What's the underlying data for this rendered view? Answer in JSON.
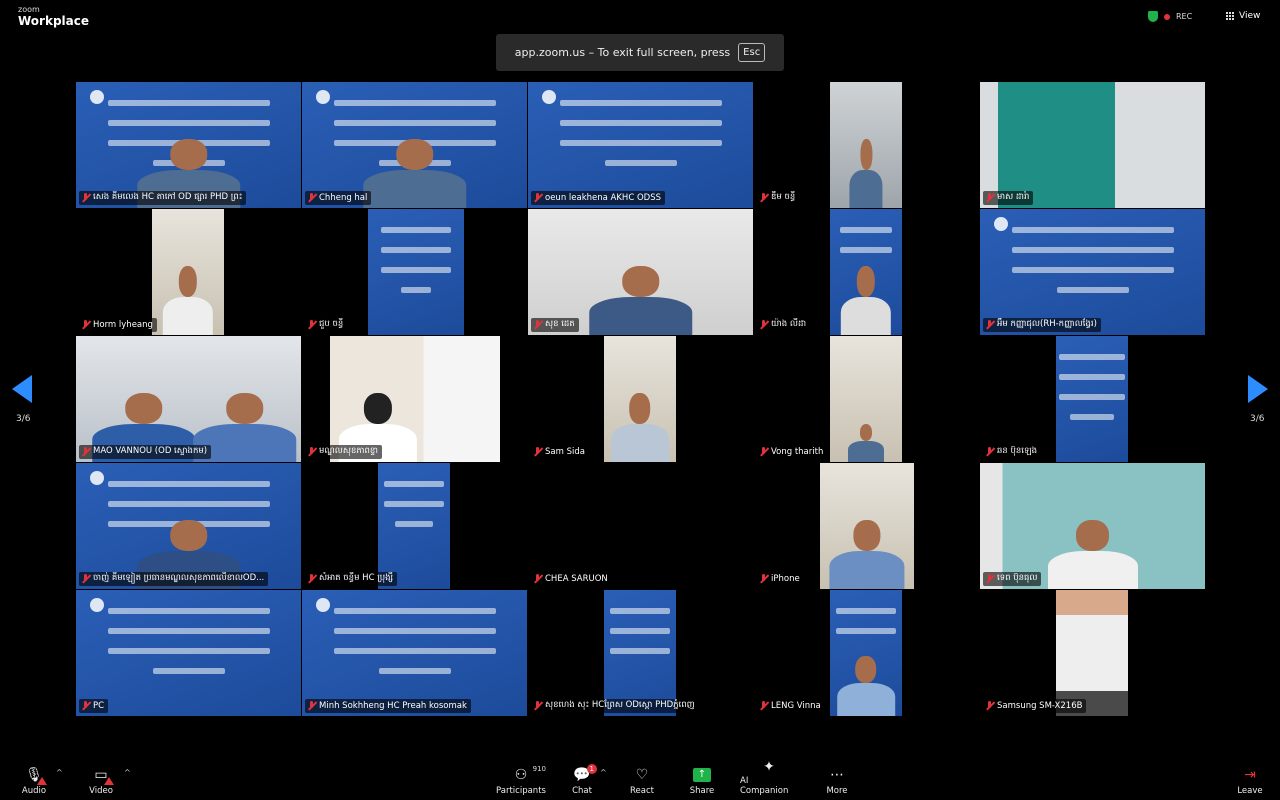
{
  "app": {
    "brand_small": "zoom",
    "brand_large": "Workplace",
    "rec_label": "REC",
    "view_label": "View"
  },
  "toast": {
    "text": "app.zoom.us – To exit full screen, press",
    "key": "Esc"
  },
  "pagination": {
    "left": "3/6",
    "right": "3/6"
  },
  "participants": [
    {
      "name": "សេង គីមលេង HC តាកៅ OD ផ្សារ PHD ព្រះ"
    },
    {
      "name": "Chheng hal"
    },
    {
      "name": "oeun leakhena AKHC ODSS"
    },
    {
      "name": "ឌឹម ចន្ធី"
    },
    {
      "name": "មាស ដារ៉ា"
    },
    {
      "name": "Horm lyheang"
    },
    {
      "name": "ជួប ចន្ធី"
    },
    {
      "name": "សុខ ដេត"
    },
    {
      "name": "យ៉ាង លីដា"
    },
    {
      "name": "អ៊ឹម កញ្ញាជុល(RH-កញ្ញាលង្វែរ)"
    },
    {
      "name": "MAO VANNOU (OD ស្ទោងកម)"
    },
    {
      "name": "មណ្ឌលសុខភាពខ្ទា"
    },
    {
      "name": "Sam Sida"
    },
    {
      "name": "Vong tharith"
    },
    {
      "name": "ឆន ប៊ុនឡេង"
    },
    {
      "name": "ចាញ់ គីមឡៀត ប្រធានមណ្ឌលសុខភាពលើខាលOD..."
    },
    {
      "name": "សំអាត ចន្ធីម HC ប្រុង្សី"
    },
    {
      "name": "CHEA SARUON"
    },
    {
      "name": "iPhone"
    },
    {
      "name": "ទេព ប៊ុនធុល"
    },
    {
      "name": "PC"
    },
    {
      "name": "Minh Sokhheng HC Preah kosomak"
    },
    {
      "name": "សុខហេង សុះ HCព្រែស ODស្ពោ PHDភ្នំពេញ"
    },
    {
      "name": "LENG Vinna"
    },
    {
      "name": "Samsung SM-X216B"
    }
  ],
  "toolbar": {
    "audio": "Audio",
    "video": "Video",
    "participants": "Participants",
    "participants_count": "910",
    "chat": "Chat",
    "chat_badge": "1",
    "react": "React",
    "share": "Share",
    "ai": "AI Companion",
    "more": "More",
    "leave": "Leave"
  },
  "colors": {
    "accent": "#2d8cff",
    "mute": "#e0333c",
    "share": "#1fb34a",
    "slide": "#1f4fa3"
  }
}
